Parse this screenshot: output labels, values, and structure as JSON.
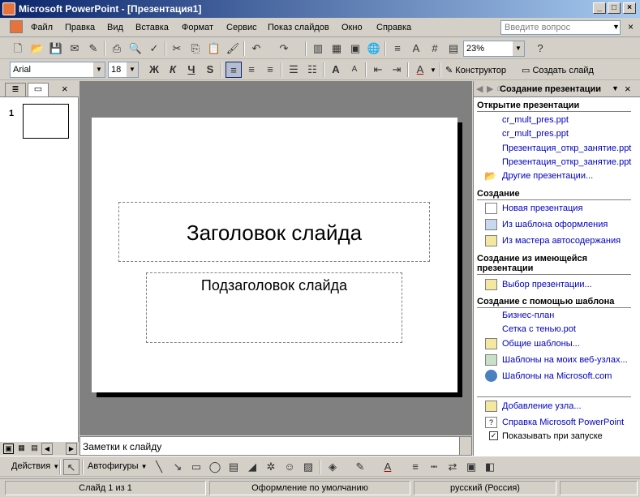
{
  "window": {
    "title": "Microsoft PowerPoint - [Презентация1]"
  },
  "menu": {
    "items": [
      "Файл",
      "Правка",
      "Вид",
      "Вставка",
      "Формат",
      "Сервис",
      "Показ слайдов",
      "Окно",
      "Справка"
    ],
    "help_placeholder": "Введите вопрос"
  },
  "standard_toolbar": {
    "zoom": "23%"
  },
  "format_toolbar": {
    "font": "Arial",
    "size": "18",
    "bold": "Ж",
    "italic": "К",
    "underline": "Ч",
    "shadow": "S",
    "design_label": "Конструктор",
    "new_slide_label": "Создать слайд"
  },
  "left_panel": {
    "slide_number": "1"
  },
  "slide": {
    "title_placeholder": "Заголовок слайда",
    "subtitle_placeholder": "Подзаголовок слайда"
  },
  "notes": {
    "placeholder": "Заметки к слайду"
  },
  "task_pane": {
    "title": "Создание презентации",
    "sections": {
      "open": {
        "title": "Открытие презентации",
        "files": [
          "cr_mult_pres.ppt",
          "cr_mult_pres.ppt",
          "Презентация_откр_занятие.ppt",
          "Презентация_откр_занятие.ppt"
        ],
        "other": "Другие презентации..."
      },
      "create": {
        "title": "Создание",
        "items": [
          "Новая презентация",
          "Из шаблона оформления",
          "Из мастера автосодержания"
        ]
      },
      "from_existing": {
        "title": "Создание из имеющейся презентации",
        "item": "Выбор презентации..."
      },
      "from_template": {
        "title": "Создание с помощью шаблона",
        "items": [
          "Бизнес-план",
          "Сетка с тенью.pot",
          "Общие шаблоны...",
          "Шаблоны на моих веб-узлах...",
          "Шаблоны на Microsoft.com"
        ]
      }
    },
    "footer": {
      "add_node": "Добавление узла...",
      "help": "Справка Microsoft PowerPoint",
      "show_on_startup": "Показывать при запуске"
    }
  },
  "draw_toolbar": {
    "actions": "Действия",
    "autoshapes": "Автофигуры"
  },
  "status": {
    "slide": "Слайд 1 из 1",
    "design": "Оформление по умолчанию",
    "language": "русский (Россия)"
  }
}
